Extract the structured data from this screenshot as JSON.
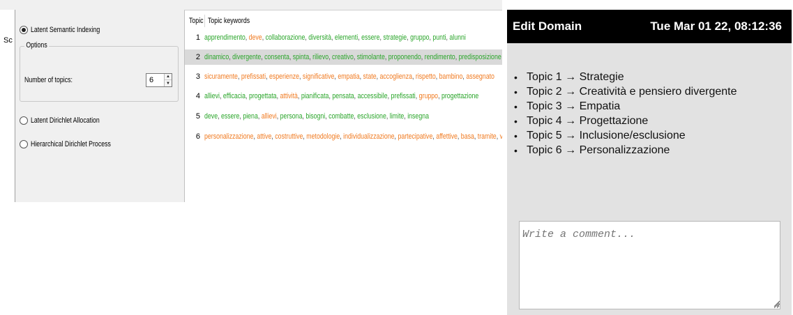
{
  "left_strip_text": "Sc",
  "methods": {
    "lsi_label": "Latent Semantic Indexing",
    "lda_label": "Latent Dirichlet Allocation",
    "hdp_label": "Hierarchical Dirichlet Process",
    "selected": "Latent Semantic Indexing"
  },
  "options": {
    "group_label": "Options",
    "num_topics_label": "Number of topics:",
    "num_topics_value": "6"
  },
  "results": {
    "col_topic": "Topic",
    "col_keywords": "Topic keywords",
    "selected_row": 2,
    "rows": [
      {
        "num": "1",
        "keywords": [
          {
            "w": "apprendimento",
            "c": "g"
          },
          {
            "w": "deve",
            "c": "o"
          },
          {
            "w": "collaborazione",
            "c": "g"
          },
          {
            "w": "diversità",
            "c": "g"
          },
          {
            "w": "elementi",
            "c": "g"
          },
          {
            "w": "essere",
            "c": "g"
          },
          {
            "w": "strategie",
            "c": "g"
          },
          {
            "w": "gruppo",
            "c": "g"
          },
          {
            "w": "punti",
            "c": "g"
          },
          {
            "w": "alunni",
            "c": "g"
          }
        ]
      },
      {
        "num": "2",
        "keywords": [
          {
            "w": "dinamico",
            "c": "g"
          },
          {
            "w": "divergente",
            "c": "g"
          },
          {
            "w": "consenta",
            "c": "g"
          },
          {
            "w": "spinta",
            "c": "g"
          },
          {
            "w": "rilievo",
            "c": "g"
          },
          {
            "w": "creativo",
            "c": "g"
          },
          {
            "w": "stimolante",
            "c": "g"
          },
          {
            "w": "proponendo",
            "c": "g"
          },
          {
            "w": "rendimento",
            "c": "g"
          },
          {
            "w": "predisposizione",
            "c": "g"
          }
        ]
      },
      {
        "num": "3",
        "keywords": [
          {
            "w": "sicuramente",
            "c": "o"
          },
          {
            "w": "prefissati",
            "c": "o"
          },
          {
            "w": "esperienze",
            "c": "o"
          },
          {
            "w": "significative",
            "c": "o"
          },
          {
            "w": "empatia",
            "c": "o"
          },
          {
            "w": "state",
            "c": "o"
          },
          {
            "w": "accoglienza",
            "c": "o"
          },
          {
            "w": "rispetto",
            "c": "o"
          },
          {
            "w": "bambino",
            "c": "o"
          },
          {
            "w": "assegnato",
            "c": "o"
          }
        ]
      },
      {
        "num": "4",
        "keywords": [
          {
            "w": "allievi",
            "c": "g"
          },
          {
            "w": "efficacia",
            "c": "g"
          },
          {
            "w": "progettata",
            "c": "g"
          },
          {
            "w": "attività",
            "c": "o"
          },
          {
            "w": "pianificata",
            "c": "g"
          },
          {
            "w": "pensata",
            "c": "g"
          },
          {
            "w": "accessibile",
            "c": "g"
          },
          {
            "w": "prefissati",
            "c": "g"
          },
          {
            "w": "gruppo",
            "c": "o"
          },
          {
            "w": "progettazione",
            "c": "g"
          }
        ]
      },
      {
        "num": "5",
        "keywords": [
          {
            "w": "deve",
            "c": "g"
          },
          {
            "w": "essere",
            "c": "g"
          },
          {
            "w": "piena",
            "c": "g"
          },
          {
            "w": "allievi",
            "c": "o"
          },
          {
            "w": "persona",
            "c": "g"
          },
          {
            "w": "bisogni",
            "c": "g"
          },
          {
            "w": "combatte",
            "c": "g"
          },
          {
            "w": "esclusione",
            "c": "g"
          },
          {
            "w": "limite",
            "c": "g"
          },
          {
            "w": "insegna",
            "c": "g"
          }
        ]
      },
      {
        "num": "6",
        "keywords": [
          {
            "w": "personalizzazione",
            "c": "o"
          },
          {
            "w": "attive",
            "c": "o"
          },
          {
            "w": "costruttive",
            "c": "o"
          },
          {
            "w": "metodologie",
            "c": "o"
          },
          {
            "w": "individualizzazione",
            "c": "o"
          },
          {
            "w": "partecipative",
            "c": "o"
          },
          {
            "w": "affettive",
            "c": "o"
          },
          {
            "w": "basa",
            "c": "o"
          },
          {
            "w": "tramite",
            "c": "o"
          },
          {
            "w": "v",
            "c": "o"
          }
        ]
      }
    ]
  },
  "domain": {
    "title": "Edit Domain",
    "datetime": "Tue Mar 01 22, 08:12:36",
    "topics": [
      "Topic 1 → Strategie",
      "Topic 2 → Creatività e pensiero divergente",
      "Topic 3 → Empatia",
      "Topic 4 → Progettazione",
      "Topic 5 → Inclusione/esclusione",
      "Topic 6 → Personalizzazione"
    ],
    "comment_placeholder": "Write a comment..."
  },
  "colors": {
    "keyword_green": "#2aa52a",
    "keyword_orange": "#f07a20",
    "selected_row": "#d9d9d9",
    "header_bg": "#000000",
    "panel_bg": "#e2e2e2"
  }
}
